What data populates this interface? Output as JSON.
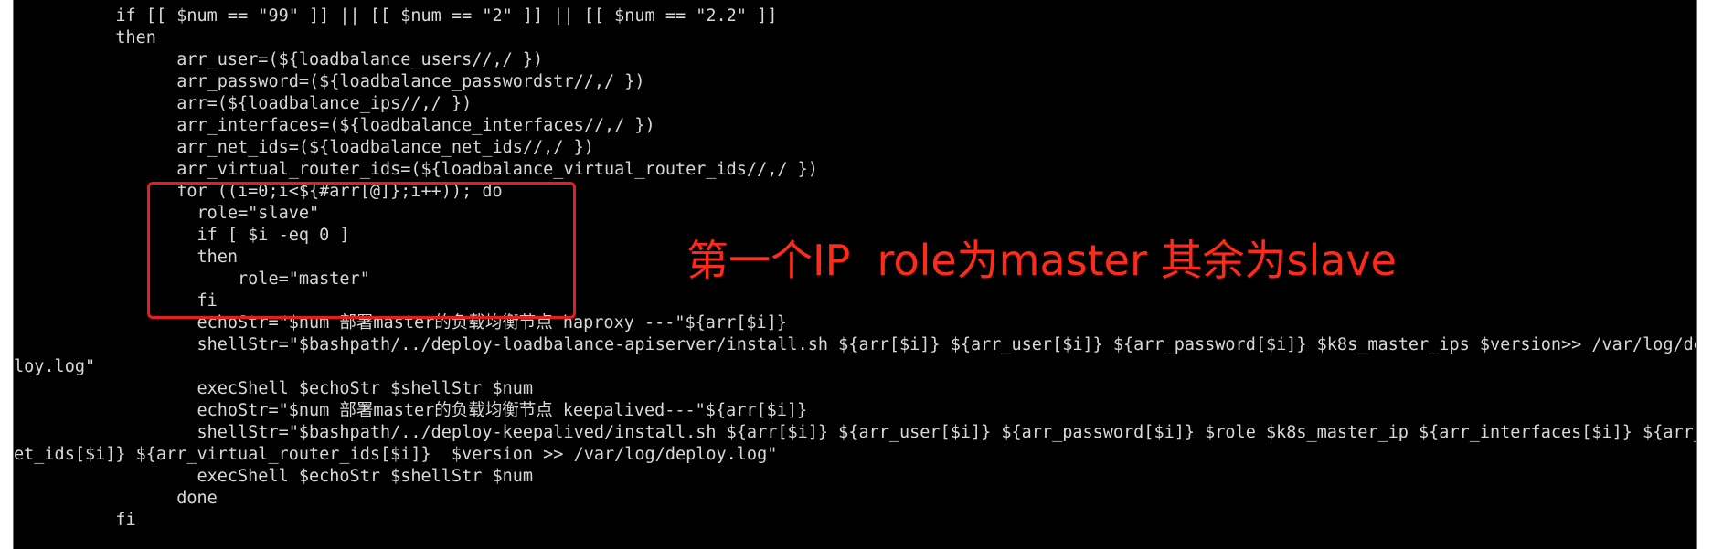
{
  "terminal": {
    "lines": [
      "          if [[ $num == \"99\" ]] || [[ $num == \"2\" ]] || [[ $num == \"2.2\" ]]",
      "          then",
      "                arr_user=(${loadbalance_users//,/ })",
      "                arr_password=(${loadbalance_passwordstr//,/ })",
      "                arr=(${loadbalance_ips//,/ })",
      "                arr_interfaces=(${loadbalance_interfaces//,/ })",
      "                arr_net_ids=(${loadbalance_net_ids//,/ })",
      "                arr_virtual_router_ids=(${loadbalance_virtual_router_ids//,/ })",
      "                for ((i=0;i<${#arr[@]};i++)); do",
      "                  role=\"slave\"",
      "                  if [ $i -eq 0 ]",
      "                  then",
      "                      role=\"master\"",
      "                  fi",
      "                  echoStr=\"$num 部署master的负载均衡节点 haproxy ---\"${arr[$i]}",
      "                  shellStr=\"$bashpath/../deploy-loadbalance-apiserver/install.sh ${arr[$i]} ${arr_user[$i]} ${arr_password[$i]} $k8s_master_ips $version>> /var/log/dep",
      "loy.log\"",
      "                  execShell $echoStr $shellStr $num",
      "                  echoStr=\"$num 部署master的负载均衡节点 keepalived---\"${arr[$i]}",
      "                  shellStr=\"$bashpath/../deploy-keepalived/install.sh ${arr[$i]} ${arr_user[$i]} ${arr_password[$i]} $role $k8s_master_ip ${arr_interfaces[$i]} ${arr_n",
      "et_ids[$i]} ${arr_virtual_router_ids[$i]}  $version >> /var/log/deploy.log\"",
      "                  execShell $echoStr $shellStr $num",
      "                done",
      "          fi"
    ]
  },
  "annotation": {
    "text": "第一个IP  role为master 其余为slave"
  },
  "colors": {
    "terminal_bg": "#000000",
    "terminal_fg": "#d8d8d8",
    "highlight": "#e61e1e",
    "annotation": "#ff2a1a"
  }
}
